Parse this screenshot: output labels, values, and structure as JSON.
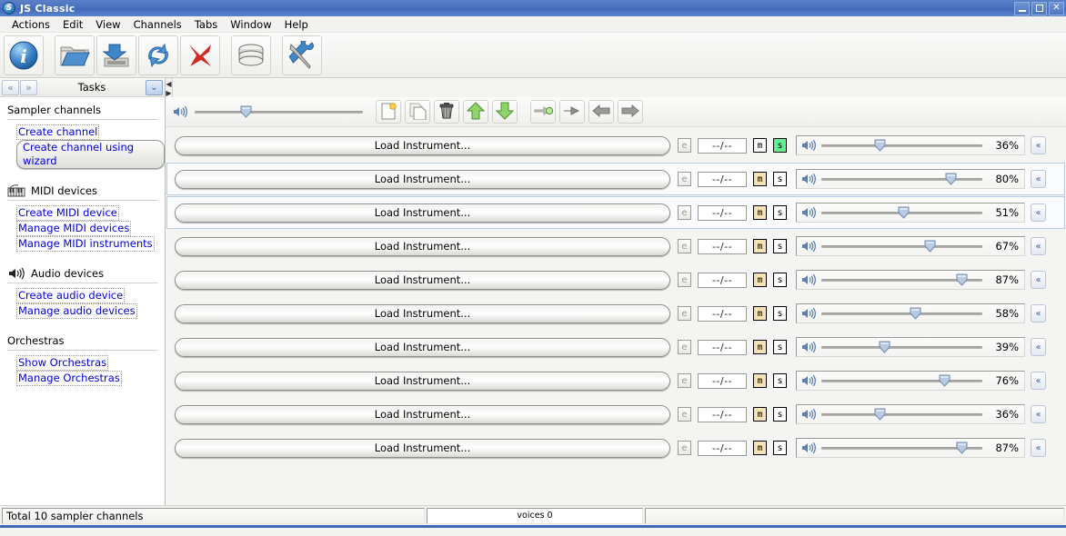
{
  "window": {
    "title": "JS Classic",
    "logo_icon": "app-logo-icon",
    "minimize_label": "–",
    "maximize_label": "□",
    "close_label": "✕"
  },
  "menubar": {
    "items": [
      "Actions",
      "Edit",
      "View",
      "Channels",
      "Tabs",
      "Window",
      "Help"
    ]
  },
  "toolbar": {
    "buttons": [
      {
        "name": "about-info-button",
        "icon": "info-icon",
        "tip": "i"
      },
      {
        "name": "open-button",
        "icon": "folder-open-icon",
        "tip": ""
      },
      {
        "name": "save-button",
        "icon": "save-disk-icon",
        "tip": ""
      },
      {
        "name": "refresh-button",
        "icon": "refresh-icon",
        "tip": ""
      },
      {
        "name": "reset-button",
        "icon": "red-x-icon",
        "tip": ""
      },
      {
        "name": "database-button",
        "icon": "database-icon",
        "tip": ""
      },
      {
        "name": "preferences-button",
        "icon": "tools-icon",
        "tip": ""
      }
    ]
  },
  "sidebar": {
    "header": {
      "back_label": "«",
      "forward_label": "»",
      "title": "Tasks",
      "collapse_label": "⌵"
    },
    "sections": [
      {
        "name": "sampler-channels",
        "label": "Sampler channels",
        "icon": "",
        "links": [
          {
            "label": "Create channel",
            "state": "normal"
          },
          {
            "label": "Create channel using wizard",
            "state": "hovered"
          }
        ]
      },
      {
        "name": "midi-devices",
        "label": "MIDI devices",
        "icon": "midi-keyboard-icon",
        "links": [
          {
            "label": "Create MIDI device",
            "state": "normal"
          },
          {
            "label": "Manage MIDI devices",
            "state": "normal"
          },
          {
            "label": "Manage MIDI instruments",
            "state": "normal"
          }
        ]
      },
      {
        "name": "audio-devices",
        "label": "Audio devices",
        "icon": "speaker-icon",
        "links": [
          {
            "label": "Create audio device",
            "state": "normal"
          },
          {
            "label": "Manage audio devices",
            "state": "normal"
          }
        ]
      },
      {
        "name": "orchestras",
        "label": "Orchestras",
        "icon": "",
        "links": [
          {
            "label": "Show Orchestras",
            "state": "normal"
          },
          {
            "label": "Manage Orchestras",
            "state": "normal"
          }
        ]
      }
    ]
  },
  "channels_toolbar": {
    "master_volume_icon": "speaker-icon",
    "master_volume_percent": 30,
    "buttons": [
      {
        "name": "new-channel-button",
        "icon": "new-document-icon"
      },
      {
        "name": "duplicate-channel-button",
        "icon": "copy-pages-icon"
      },
      {
        "name": "remove-channel-button",
        "icon": "trash-can-icon"
      },
      {
        "name": "move-channel-up-button",
        "icon": "green-up-arrow-icon"
      },
      {
        "name": "move-channel-down-button",
        "icon": "green-down-arrow-icon"
      },
      {
        "name": "move-to-new-tab-button",
        "icon": "move-to-new-tab-icon"
      },
      {
        "name": "move-to-tab-button",
        "icon": "move-to-tab-icon"
      },
      {
        "name": "move-left-button",
        "icon": "gray-left-arrow-icon"
      },
      {
        "name": "move-right-button",
        "icon": "gray-right-arrow-icon"
      }
    ]
  },
  "channels": {
    "load_label": "Load Instrument...",
    "fx_value": "--/--",
    "edit_label": "e",
    "mute_label": "m",
    "solo_label": "s",
    "expand_label": "«",
    "speaker_icon": "speaker-icon",
    "rows": [
      {
        "index": 1,
        "selected": false,
        "mute": "off",
        "solo": "on",
        "volume_percent": 36,
        "volume_text": "36%"
      },
      {
        "index": 2,
        "selected": true,
        "mute": "on",
        "solo": "off",
        "volume_percent": 80,
        "volume_text": "80%"
      },
      {
        "index": 3,
        "selected": true,
        "mute": "on",
        "solo": "off",
        "volume_percent": 51,
        "volume_text": "51%"
      },
      {
        "index": 4,
        "selected": false,
        "mute": "on",
        "solo": "off",
        "volume_percent": 67,
        "volume_text": "67%"
      },
      {
        "index": 5,
        "selected": false,
        "mute": "on",
        "solo": "off",
        "volume_percent": 87,
        "volume_text": "87%"
      },
      {
        "index": 6,
        "selected": false,
        "mute": "on",
        "solo": "off",
        "volume_percent": 58,
        "volume_text": "58%"
      },
      {
        "index": 7,
        "selected": false,
        "mute": "on",
        "solo": "off",
        "volume_percent": 39,
        "volume_text": "39%"
      },
      {
        "index": 8,
        "selected": false,
        "mute": "on",
        "solo": "off",
        "volume_percent": 76,
        "volume_text": "76%"
      },
      {
        "index": 9,
        "selected": false,
        "mute": "on",
        "solo": "off",
        "volume_percent": 36,
        "volume_text": "36%"
      },
      {
        "index": 10,
        "selected": false,
        "mute": "on",
        "solo": "off",
        "volume_percent": 87,
        "volume_text": "87%"
      }
    ]
  },
  "statusbar": {
    "total_text": "Total 10 sampler channels",
    "voices_text": "voices 0",
    "extra_text": ""
  },
  "colors": {
    "titlebar": "#4069b8",
    "solo_on": "#5ff08f",
    "mute_on": "#f5e3b4",
    "link": "#0000d8",
    "selection_border": "#b7cbe6"
  }
}
